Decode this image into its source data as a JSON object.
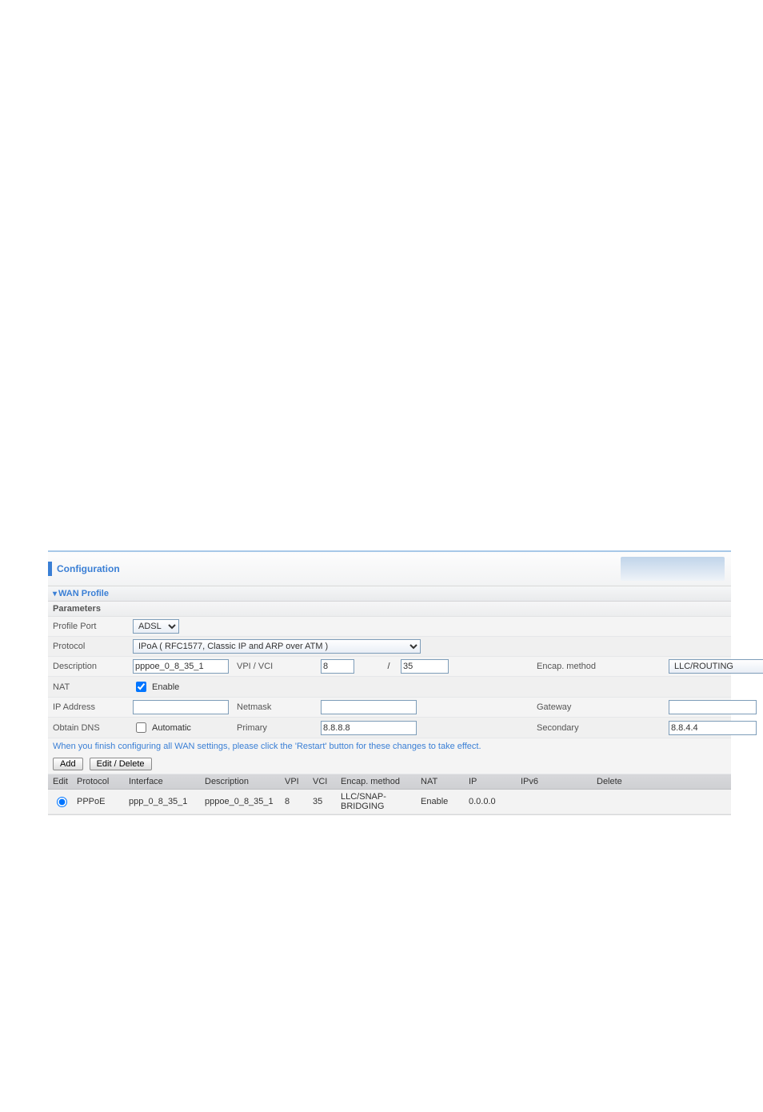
{
  "header": {
    "title": "Configuration"
  },
  "section": {
    "title": "WAN Profile",
    "subtitle": "Parameters"
  },
  "rows": {
    "profile_port": {
      "label": "Profile Port",
      "value": "ADSL"
    },
    "protocol": {
      "label": "Protocol",
      "value": "IPoA ( RFC1577, Classic IP and ARP over ATM )"
    },
    "description": {
      "label": "Description",
      "value": "pppoe_0_8_35_1",
      "vpivci_label": "VPI / VCI",
      "vpi": "8",
      "vci": "35",
      "encap_label": "Encap. method",
      "encap_value": "LLC/ROUTING"
    },
    "nat": {
      "label": "NAT",
      "enable_label": "Enable",
      "checked": true
    },
    "ip": {
      "label": "IP Address",
      "ip": "",
      "netmask_label": "Netmask",
      "netmask": "",
      "gateway_label": "Gateway",
      "gateway": ""
    },
    "dns": {
      "label": "Obtain DNS",
      "auto_label": "Automatic",
      "auto_checked": false,
      "primary_label": "Primary",
      "primary": "8.8.8.8",
      "secondary_label": "Secondary",
      "secondary": "8.8.4.4"
    }
  },
  "note": "When you finish configuring all WAN settings, please click the 'Restart' button for these changes to take effect.",
  "buttons": {
    "add": "Add",
    "edit": "Edit / Delete"
  },
  "table": {
    "headers": {
      "edit": "Edit",
      "protocol": "Protocol",
      "interface": "Interface",
      "description": "Description",
      "vpi": "VPI",
      "vci": "VCI",
      "encap": "Encap. method",
      "nat": "NAT",
      "ip": "IP",
      "ipv6": "IPv6",
      "delete": "Delete"
    },
    "rows": [
      {
        "protocol": "PPPoE",
        "interface": "ppp_0_8_35_1",
        "description": "pppoe_0_8_35_1",
        "vpi": "8",
        "vci": "35",
        "encap": "LLC/SNAP-BRIDGING",
        "nat": "Enable",
        "ip": "0.0.0.0",
        "ipv6": "",
        "selected": true
      }
    ]
  }
}
